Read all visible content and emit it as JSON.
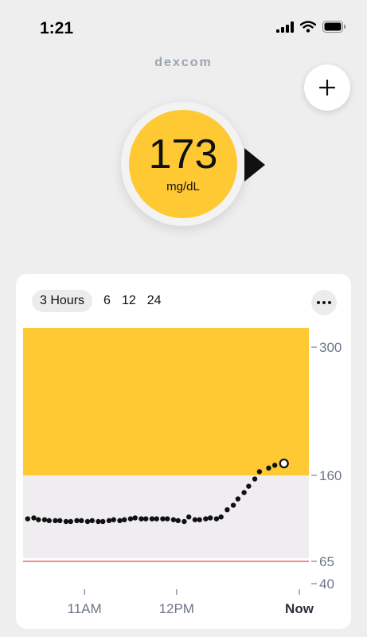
{
  "status_bar": {
    "time": "1:21"
  },
  "brand": "Dexcom",
  "reading": {
    "value": "173",
    "unit": "mg/dL",
    "trend": "steady"
  },
  "range_tabs": [
    "3 Hours",
    "6",
    "12",
    "24"
  ],
  "active_range": "3 Hours",
  "chart_data": {
    "type": "scatter",
    "x_ticks": [
      "11AM",
      "12PM",
      "Now"
    ],
    "y_ticks": [
      300,
      160,
      65,
      40
    ],
    "ylim": [
      40,
      320
    ],
    "high_threshold": 160,
    "low_threshold": 65,
    "high_zone_color": "#fec933",
    "target_zone_color": "#efedf0",
    "low_line_color": "#e74c3c",
    "x_range_minutes": [
      -180,
      0
    ],
    "tick_minutes": [
      -140,
      -80,
      0
    ],
    "points": [
      [
        -177,
        112
      ],
      [
        -173,
        113
      ],
      [
        -170,
        111
      ],
      [
        -166,
        111
      ],
      [
        -163,
        110
      ],
      [
        -159,
        110
      ],
      [
        -156,
        110
      ],
      [
        -152,
        109
      ],
      [
        -149,
        109
      ],
      [
        -145,
        110
      ],
      [
        -142,
        110
      ],
      [
        -138,
        109
      ],
      [
        -135,
        110
      ],
      [
        -131,
        109
      ],
      [
        -128,
        109
      ],
      [
        -124,
        110
      ],
      [
        -121,
        111
      ],
      [
        -117,
        110
      ],
      [
        -114,
        111
      ],
      [
        -110,
        112
      ],
      [
        -107,
        113
      ],
      [
        -103,
        112
      ],
      [
        -100,
        112
      ],
      [
        -96,
        112
      ],
      [
        -93,
        112
      ],
      [
        -89,
        112
      ],
      [
        -86,
        112
      ],
      [
        -82,
        111
      ],
      [
        -79,
        110
      ],
      [
        -75,
        109
      ],
      [
        -72,
        114
      ],
      [
        -68,
        111
      ],
      [
        -65,
        111
      ],
      [
        -61,
        112
      ],
      [
        -58,
        113
      ],
      [
        -54,
        112
      ],
      [
        -51,
        114
      ],
      [
        -47,
        122
      ],
      [
        -43,
        127
      ],
      [
        -40,
        134
      ],
      [
        -36,
        141
      ],
      [
        -33,
        148
      ],
      [
        -29,
        156
      ],
      [
        -26,
        164
      ],
      [
        -20,
        168
      ],
      [
        -16,
        171
      ],
      [
        -10,
        173
      ]
    ],
    "current": [
      -10,
      173
    ]
  }
}
